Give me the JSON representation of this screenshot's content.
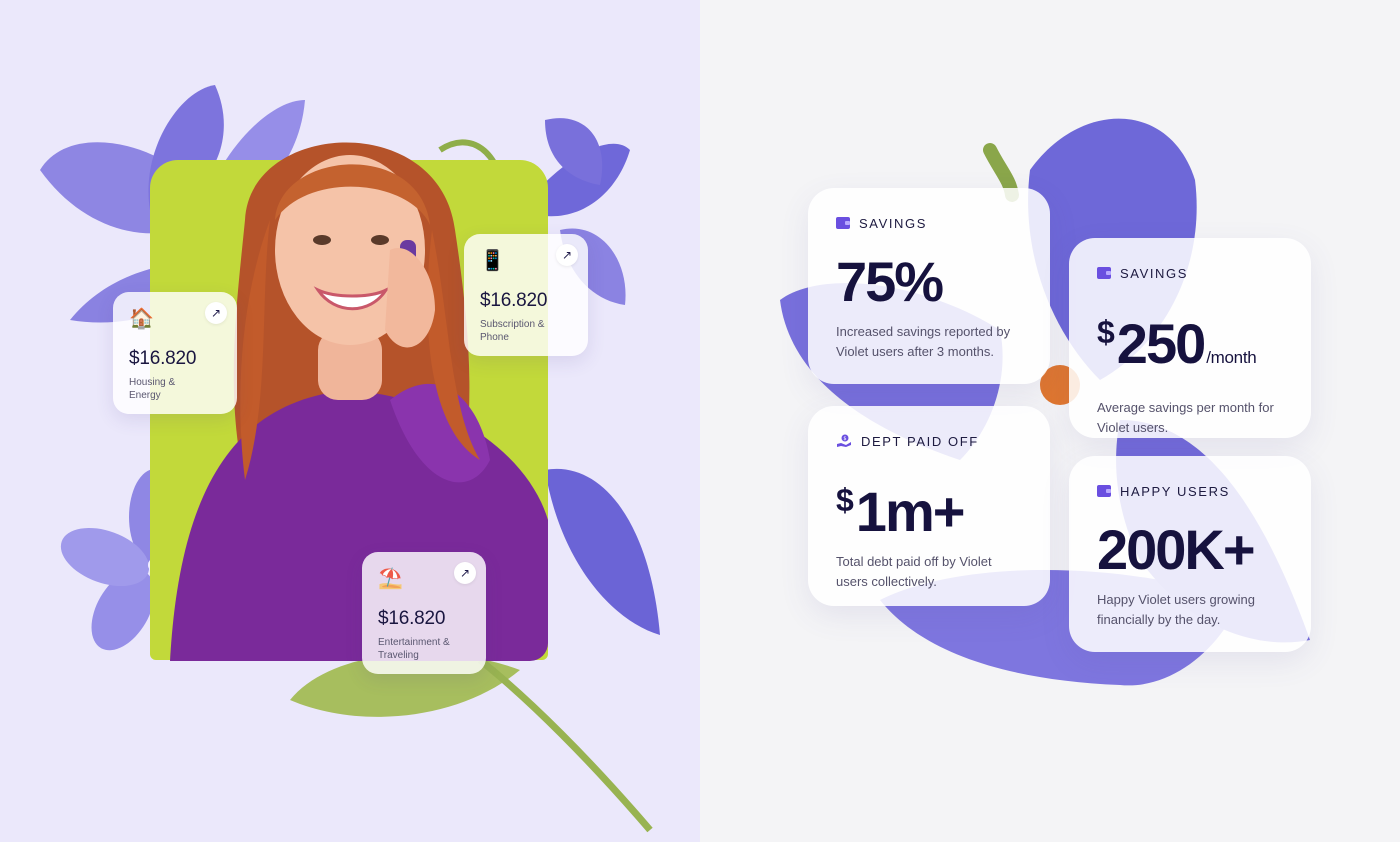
{
  "colors": {
    "accent": "#6a4fe0",
    "lime": "#c2d93a",
    "text_dark": "#16123e",
    "left_bg": "#ebe8fb",
    "right_bg": "#f4f4f6"
  },
  "left": {
    "cards": [
      {
        "icon": "house-icon",
        "emoji": "🏠",
        "amount": "$16.820",
        "label": "Housing & Energy"
      },
      {
        "icon": "phone-icon",
        "emoji": "📱",
        "amount": "$16.820",
        "label": "Subscription & Phone"
      },
      {
        "icon": "beach-umbrella-icon",
        "emoji": "⛱️",
        "amount": "$16.820",
        "label": "Entertainment & Traveling"
      }
    ],
    "arrow_glyph": "↗"
  },
  "right": {
    "stats": [
      {
        "icon": "wallet-icon",
        "label": "SAVINGS",
        "prefix": "",
        "value": "75%",
        "unit": "",
        "desc": "Increased savings reported by Violet users after 3 months."
      },
      {
        "icon": "wallet-icon",
        "label": "SAVINGS",
        "prefix": "$",
        "value": "250",
        "unit": "/month",
        "desc": "Average savings per month for Violet users."
      },
      {
        "icon": "hand-money-icon",
        "label": "DEPT PAID OFF",
        "prefix": "$",
        "value": "1m+",
        "unit": "",
        "desc": "Total debt paid off by Violet users collectively."
      },
      {
        "icon": "wallet-icon",
        "label": "HAPPY USERS",
        "prefix": "",
        "value": "200K+",
        "unit": "",
        "desc": "Happy Violet users growing financially by the day."
      }
    ]
  }
}
